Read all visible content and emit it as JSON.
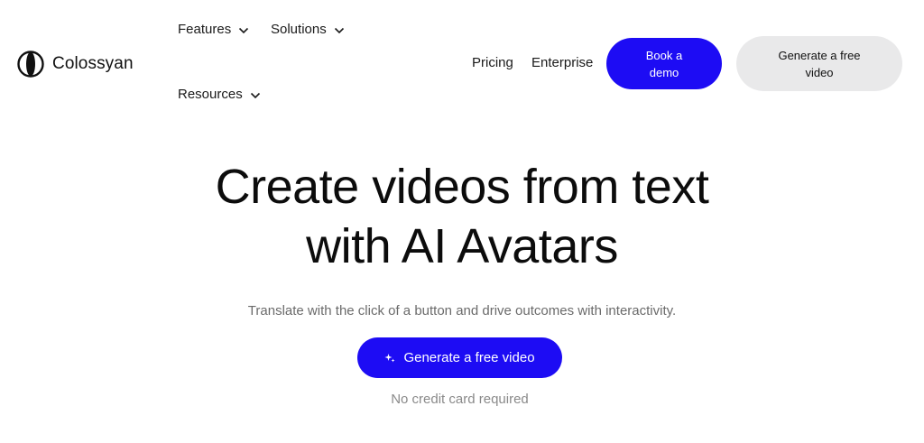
{
  "brand": {
    "name": "Colossyan",
    "logo_icon": "colossyan-logo-icon"
  },
  "nav": {
    "features": "Features",
    "solutions": "Solutions",
    "resources": "Resources",
    "pricing": "Pricing",
    "enterprise": "Enterprise",
    "book_demo": "Book a demo",
    "generate_free": "Generate a free video"
  },
  "hero": {
    "title_line1": "Create videos from text",
    "title_line2": "with AI Avatars",
    "subtitle": "Translate with the click of a button and drive outcomes with interactivity.",
    "cta": "Generate a free video",
    "cta_icon": "sparkle-icon",
    "note": "No credit card required"
  },
  "colors": {
    "primary": "#1d0cf4",
    "secondary_button": "#e9e9ea",
    "muted_text": "#6b6b6b"
  }
}
